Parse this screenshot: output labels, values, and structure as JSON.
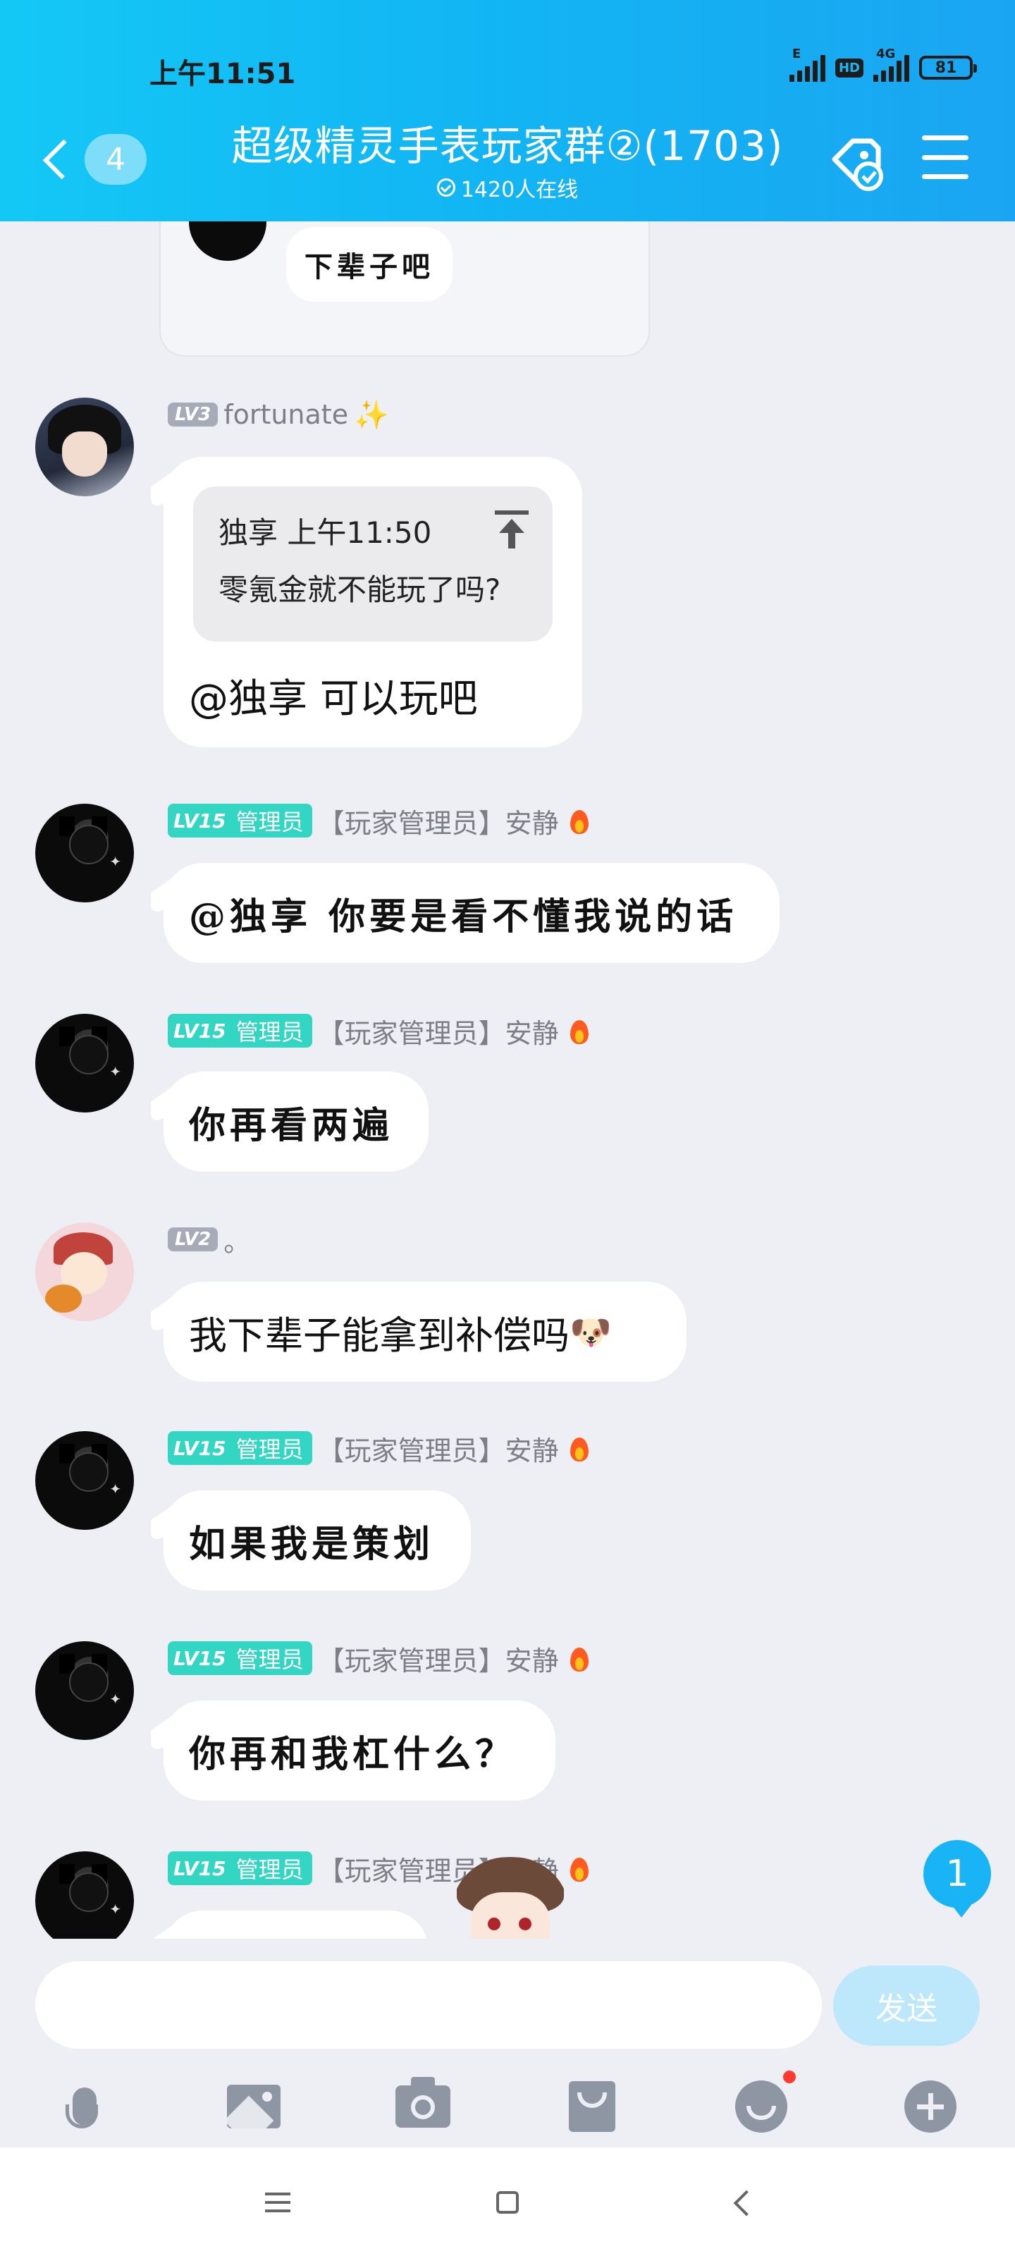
{
  "status_bar": {
    "time": "上午11:51",
    "net1": "E",
    "hd": "HD",
    "net2": "4G",
    "battery": "81"
  },
  "header": {
    "back_count": "4",
    "title": "超级精灵手表玩家群②(1703)",
    "online": "1420人在线"
  },
  "sticker": {
    "text": "下辈子吧"
  },
  "messages": [
    {
      "level": "LV3",
      "name": "fortunate",
      "name_suffix": "✨",
      "reply": {
        "author_time": "独享 上午11:50",
        "text": "零氪金就不能玩了吗?"
      },
      "text": "@独享 可以玩吧"
    },
    {
      "level": "LV15",
      "role": "管理员",
      "name": "【玩家管理员】安静",
      "text": "@独享 你要是看不懂我说的话"
    },
    {
      "level": "LV15",
      "role": "管理员",
      "name": "【玩家管理员】安静",
      "text": "你再看两遍"
    },
    {
      "level": "LV2",
      "name": "。",
      "text": "我下辈子能拿到补偿吗",
      "emoji": "🐶"
    },
    {
      "level": "LV15",
      "role": "管理员",
      "name": "【玩家管理员】安静",
      "text": "如果我是策划"
    },
    {
      "level": "LV15",
      "role": "管理员",
      "name": "【玩家管理员】安静",
      "text": "你再和我杠什么？"
    },
    {
      "level": "LV15",
      "role": "管理员",
      "name": "【玩家管理员】安静"
    }
  ],
  "new_messages_badge": "1",
  "input": {
    "placeholder": "",
    "send_label": "发送"
  },
  "toolbar": [
    "mic-icon",
    "image-icon",
    "camera-icon",
    "red-packet-icon",
    "emoji-icon",
    "plus-icon"
  ],
  "colors": {
    "header": "#12B6F3",
    "admin_badge": "#32D6C2",
    "level_badge": "#A7ABB8",
    "send_disabled": "#BDE8FB"
  }
}
